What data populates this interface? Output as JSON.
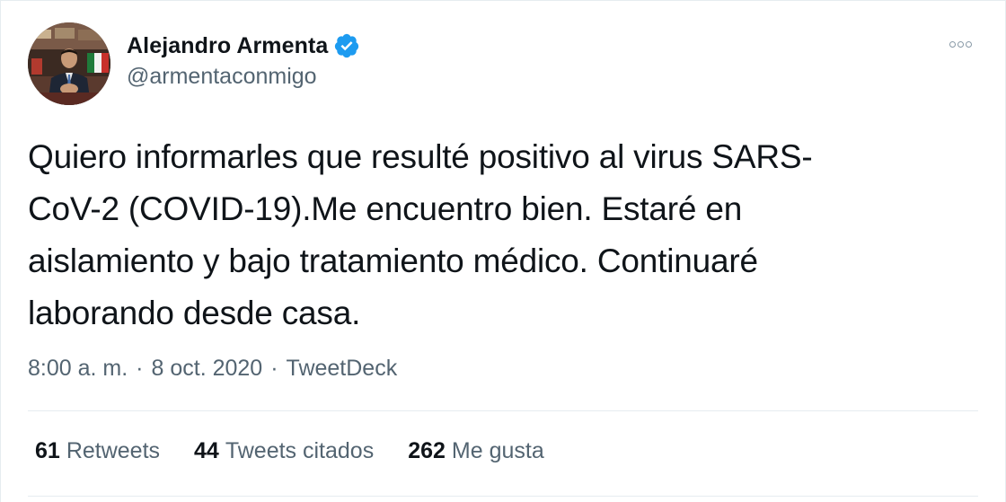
{
  "author": {
    "display_name": "Alejandro Armenta",
    "handle": "@armentaconmigo",
    "verified_icon": "verified-badge-icon",
    "avatar_icon": "profile-photo"
  },
  "menu": {
    "more_icon": "more-options-icon"
  },
  "tweet": {
    "text": "Quiero informarles que resulté positivo al virus SARS-\nCoV-2 (COVID-19).Me encuentro bien. Estaré en\naislamiento y bajo tratamiento médico. Continuaré\nlaborando desde casa.",
    "time": "8:00 a. m.",
    "separator": "·",
    "date": "8 oct. 2020",
    "source": "TweetDeck"
  },
  "stats": {
    "retweets_count": "61",
    "retweets_label": "Retweets",
    "quotes_count": "44",
    "quotes_label": "Tweets citados",
    "likes_count": "262",
    "likes_label": "Me gusta"
  },
  "colors": {
    "verified_blue": "#1d9bf0",
    "secondary_text": "#536471",
    "divider": "#e6ecf0"
  }
}
